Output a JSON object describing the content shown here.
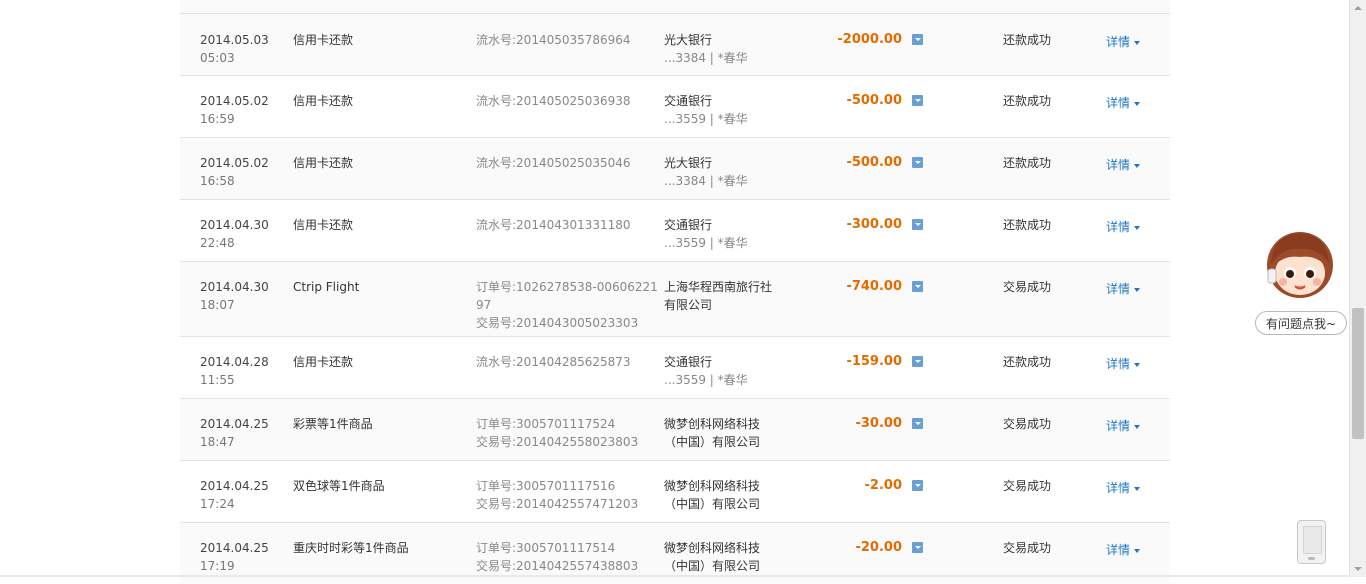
{
  "rows": [
    {
      "date": "2014.05.03",
      "time": "05:03",
      "name": "信用卡还款",
      "serial": [
        "流水号:201405035786964"
      ],
      "party": [
        "光大银行"
      ],
      "party_sub": "...3384 | *春华",
      "amount": "-2000.00",
      "status": "还款成功",
      "detail": "详情"
    },
    {
      "date": "2014.05.02",
      "time": "16:59",
      "name": "信用卡还款",
      "serial": [
        "流水号:201405025036938"
      ],
      "party": [
        "交通银行"
      ],
      "party_sub": "...3559 | *春华",
      "amount": "-500.00",
      "status": "还款成功",
      "detail": "详情"
    },
    {
      "date": "2014.05.02",
      "time": "16:58",
      "name": "信用卡还款",
      "serial": [
        "流水号:201405025035046"
      ],
      "party": [
        "光大银行"
      ],
      "party_sub": "...3384 | *春华",
      "amount": "-500.00",
      "status": "还款成功",
      "detail": "详情"
    },
    {
      "date": "2014.04.30",
      "time": "22:48",
      "name": "信用卡还款",
      "serial": [
        "流水号:201404301331180"
      ],
      "party": [
        "交通银行"
      ],
      "party_sub": "...3559 | *春华",
      "amount": "-300.00",
      "status": "还款成功",
      "detail": "详情"
    },
    {
      "date": "2014.04.30",
      "time": "18:07",
      "name": "Ctrip Flight",
      "serial": [
        "订单号:1026278538-0060622197",
        "交易号:2014043005023303"
      ],
      "party": [
        "上海华程西南旅行社",
        "有限公司"
      ],
      "party_sub": "",
      "amount": "-740.00",
      "status": "交易成功",
      "detail": "详情"
    },
    {
      "date": "2014.04.28",
      "time": "11:55",
      "name": "信用卡还款",
      "serial": [
        "流水号:201404285625873"
      ],
      "party": [
        "交通银行"
      ],
      "party_sub": "...3559 | *春华",
      "amount": "-159.00",
      "status": "还款成功",
      "detail": "详情"
    },
    {
      "date": "2014.04.25",
      "time": "18:47",
      "name": "彩票等1件商品",
      "serial": [
        "订单号:3005701117524",
        "交易号:2014042558023803"
      ],
      "party": [
        "微梦创科网络科技",
        "（中国）有限公司"
      ],
      "party_sub": "",
      "amount": "-30.00",
      "status": "交易成功",
      "detail": "详情"
    },
    {
      "date": "2014.04.25",
      "time": "17:24",
      "name": "双色球等1件商品",
      "serial": [
        "订单号:3005701117516",
        "交易号:2014042557471203"
      ],
      "party": [
        "微梦创科网络科技",
        "（中国）有限公司"
      ],
      "party_sub": "",
      "amount": "-2.00",
      "status": "交易成功",
      "detail": "详情"
    },
    {
      "date": "2014.04.25",
      "time": "17:19",
      "name": "重庆时时彩等1件商品",
      "serial": [
        "订单号:3005701117514",
        "交易号:2014042557438803"
      ],
      "party": [
        "微梦创科网络科技",
        "（中国）有限公司"
      ],
      "party_sub": "",
      "amount": "-20.00",
      "status": "交易成功",
      "detail": "详情"
    }
  ],
  "helper": {
    "label": "有问题点我~"
  },
  "colors": {
    "amount": "#e36b00",
    "link": "#1f76c4",
    "toggle": "#6a9fd4"
  }
}
